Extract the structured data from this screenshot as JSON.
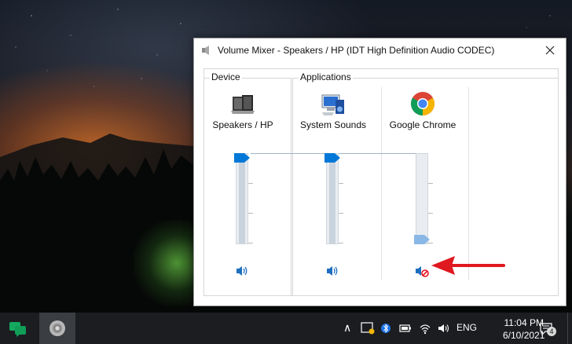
{
  "window": {
    "title": "Volume Mixer - Speakers / HP (IDT High Definition Audio CODEC)",
    "close_glyph": "✕"
  },
  "groups": {
    "device_label": "Device",
    "applications_label": "Applications"
  },
  "channels": [
    {
      "name": "Speakers / HP",
      "icon": "speakers-icon",
      "volume_percent": 100,
      "muted": false
    },
    {
      "name": "System Sounds",
      "icon": "system-sounds-icon",
      "volume_percent": 100,
      "muted": false
    },
    {
      "name": "Google Chrome",
      "icon": "chrome-icon",
      "volume_percent": 0,
      "muted": true
    }
  ],
  "colors": {
    "accent": "#0078d7",
    "annotation_arrow": "#e0181f",
    "taskbar": "#1b1d20",
    "muted_badge": "#e81123"
  },
  "taskbar": {
    "apps": [
      {
        "name": "Google Hangouts",
        "icon": "chat-icon",
        "active": false
      },
      {
        "name": "Volume Mixer",
        "icon": "speaker-app-icon",
        "active": true
      }
    ],
    "tray": {
      "chevron": "∧",
      "language": "ENG",
      "time": "11:04 PM",
      "date": "6/10/2021",
      "notification_count": "4"
    }
  }
}
